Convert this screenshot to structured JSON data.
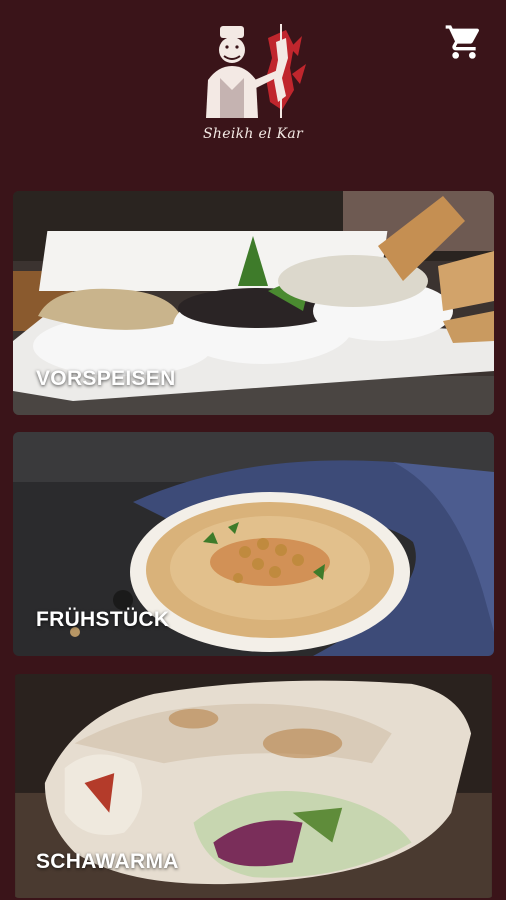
{
  "header": {
    "logo_text": "Sheikh el Kar",
    "cart_icon": "shopping-cart-icon"
  },
  "categories": [
    {
      "label": "VORSPEISEN"
    },
    {
      "label": "FRÜHSTÜCK"
    },
    {
      "label": "SCHAWARMA"
    }
  ],
  "colors": {
    "background": "#3a1419",
    "label_text": "#ffffff",
    "logo_accent": "#c0262d"
  }
}
